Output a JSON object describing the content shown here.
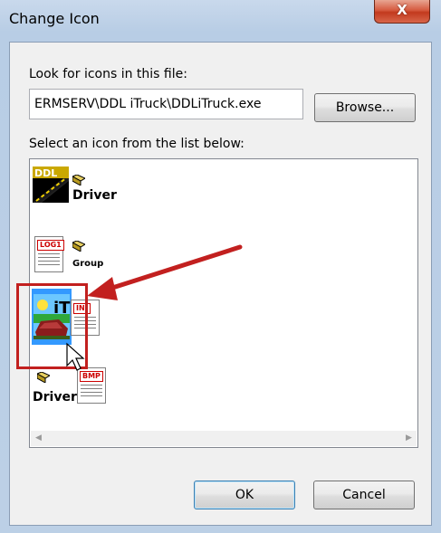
{
  "window": {
    "title": "Change Icon",
    "close_label": "X"
  },
  "file_section": {
    "label": "Look for icons in this file:",
    "path_value": "ERMSERV\\DDL iTruck\\DDLiTruck.exe",
    "browse_label": "Browse..."
  },
  "list_section": {
    "label": "Select an icon from the list below:",
    "icons": {
      "ddl_text": "DDL",
      "driver_caption_1": "Driver",
      "log_tag": "LOG1",
      "group_caption": "Group",
      "itruck_text": "iT",
      "ini_tag": "INI",
      "driver_caption_2": "Driver",
      "bmp_tag": "BMP"
    }
  },
  "buttons": {
    "ok_label": "OK",
    "cancel_label": "Cancel"
  },
  "colors": {
    "annotation_red": "#c2201f",
    "selection_blue": "#3399ff"
  }
}
